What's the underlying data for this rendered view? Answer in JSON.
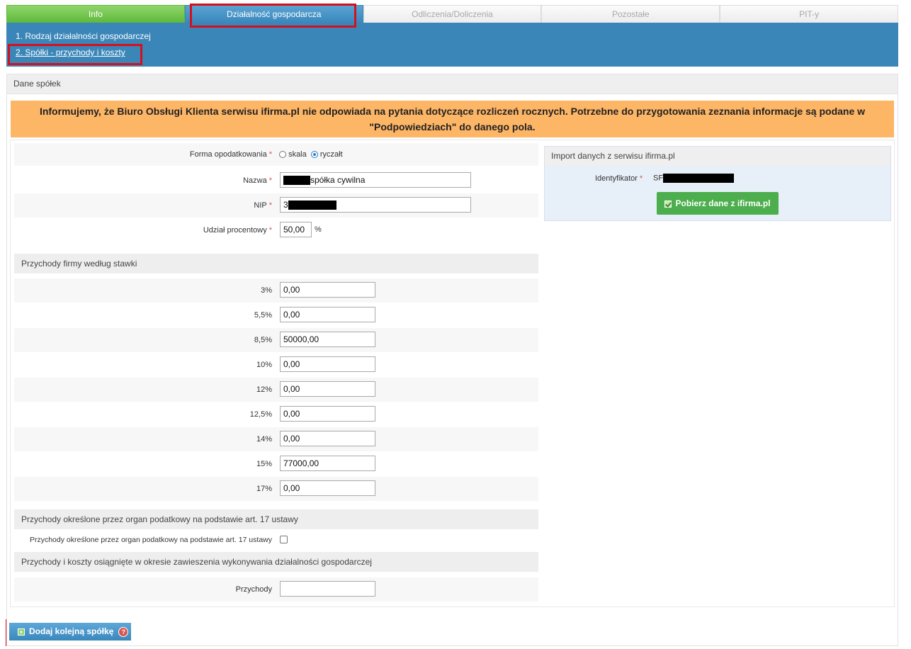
{
  "tabs": [
    {
      "label": "Info"
    },
    {
      "label": "Działalność gospodarcza"
    },
    {
      "label": "Odliczenia/Doliczenia"
    },
    {
      "label": "Pozostałe"
    },
    {
      "label": "PIT-y"
    }
  ],
  "subnav": {
    "item1": "1. Rodzaj działalności gospodarczej",
    "item2": "2. Spółki - przychody i koszty"
  },
  "panel": {
    "title": "Dane spółek",
    "notice": "Informujemy, że Biuro Obsługi Klienta serwisu ifirma.pl nie odpowiada na pytania dotyczące rozliczeń rocznych. Potrzebne do przygotowania zeznania informacje są podane w \"Podpowiedziach\" do danego pola."
  },
  "form": {
    "taxation_label": "Forma opodatkowania",
    "opt_skala": "skala",
    "opt_ryczalt": "ryczałt",
    "selected": "ryczałt",
    "name_label": "Nazwa",
    "name_value": "spółka cywilna",
    "nip_label": "NIP",
    "nip_value": "3",
    "share_label": "Udział procentowy",
    "share_value": "50,00",
    "share_unit": "%"
  },
  "rates": {
    "header": "Przychody firmy według stawki",
    "items": [
      {
        "rate": "3%",
        "value": "0,00"
      },
      {
        "rate": "5,5%",
        "value": "0,00"
      },
      {
        "rate": "8,5%",
        "value": "50000,00"
      },
      {
        "rate": "10%",
        "value": "0,00"
      },
      {
        "rate": "12%",
        "value": "0,00"
      },
      {
        "rate": "12,5%",
        "value": "0,00"
      },
      {
        "rate": "14%",
        "value": "0,00"
      },
      {
        "rate": "15%",
        "value": "77000,00"
      },
      {
        "rate": "17%",
        "value": "0,00"
      }
    ]
  },
  "art17": {
    "header": "Przychody określone przez organ podatkowy na podstawie art. 17 ustawy",
    "label": "Przychody określone przez organ podatkowy na podstawie art. 17 ustawy",
    "checked": false
  },
  "suspension": {
    "header": "Przychody i koszty osiągnięte w okresie zawieszenia wykonywania działalności gospodarczej",
    "label": "Przychody",
    "value": ""
  },
  "import": {
    "title": "Import danych z serwisu ifirma.pl",
    "id_label": "Identyfikator",
    "id_value": "SF",
    "button": "Pobierz dane z ifirma.pl"
  },
  "add_button": "Dodaj kolejną spółkę",
  "help_icon": "?",
  "colors": {
    "tab_info": "#5fb93b",
    "tab_active": "#3a87bd",
    "blue_bar": "#3b86b8",
    "notice_bg": "#fdb566",
    "highlight_red": "#d4101d",
    "button_green": "#4cae4c",
    "required_star": "#d9534f"
  }
}
